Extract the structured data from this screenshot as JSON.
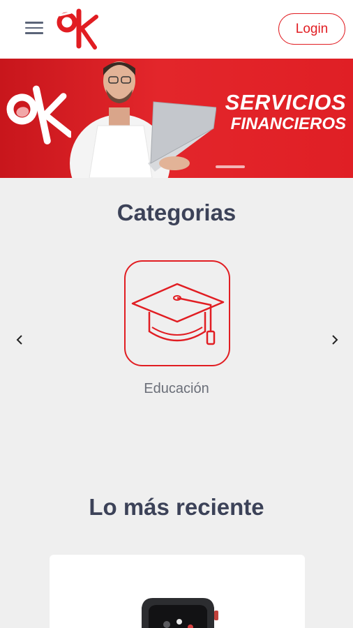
{
  "header": {
    "menu_icon": "hamburger-menu-icon",
    "logo": "OK",
    "login_label": "Login"
  },
  "banner": {
    "logo": "OK",
    "title_line1": "SERVICIOS",
    "title_line2": "FINANCIEROS",
    "slides": 1
  },
  "categories": {
    "title": "Categorias",
    "items": [
      {
        "label": "Educación",
        "icon": "graduation-cap-icon"
      }
    ],
    "prev_icon": "chevron-left-icon",
    "next_icon": "chevron-right-icon"
  },
  "recent": {
    "title": "Lo más reciente",
    "items": [
      {
        "icon": "smartwatch-icon"
      }
    ]
  },
  "colors": {
    "brand_red": "#e11d22",
    "background": "#efefef",
    "heading": "#3c4258"
  }
}
